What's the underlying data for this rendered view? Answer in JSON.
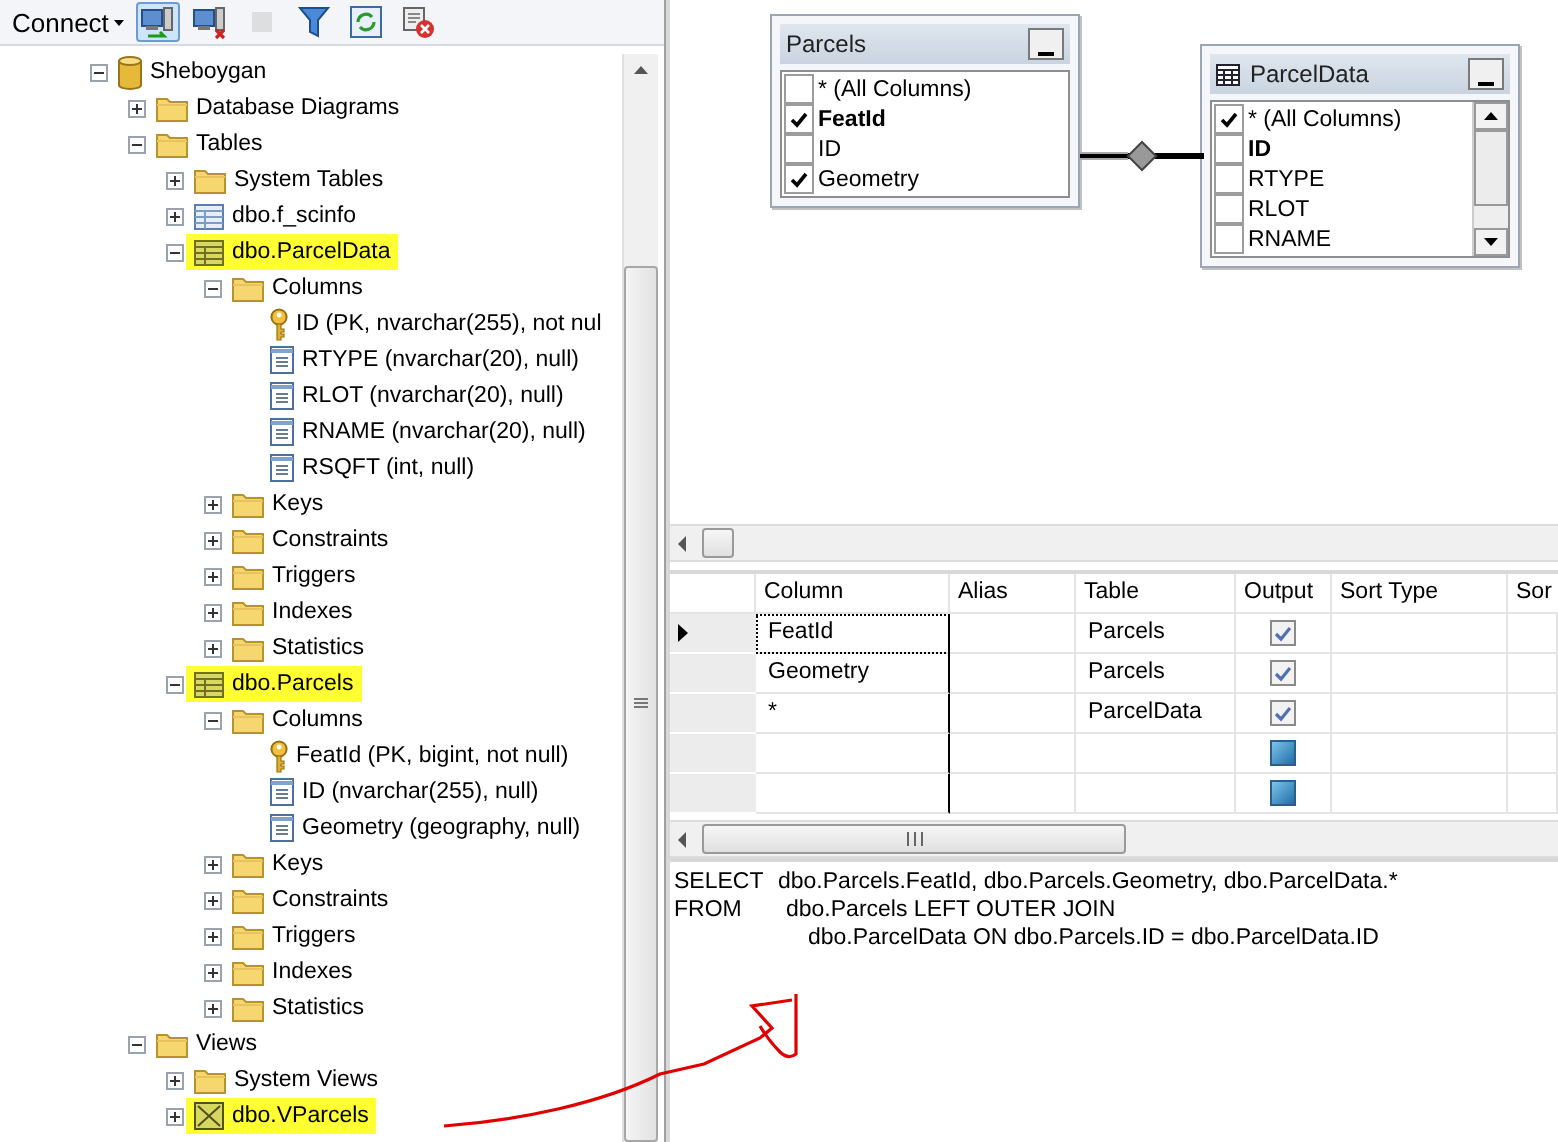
{
  "toolbar": {
    "connect_label": "Connect",
    "tools": [
      {
        "kind": "connect",
        "selected": true,
        "disabled": false
      },
      {
        "kind": "disconnect",
        "selected": false,
        "disabled": false
      },
      {
        "kind": "stop",
        "selected": false,
        "disabled": true
      },
      {
        "kind": "filter",
        "selected": false,
        "disabled": false
      },
      {
        "kind": "refresh",
        "selected": false,
        "disabled": false
      },
      {
        "kind": "script",
        "selected": false,
        "disabled": false
      }
    ]
  },
  "tree": [
    {
      "label": "Sheboygan",
      "kind": "database",
      "expanded": true,
      "highlighted": false,
      "children": [
        {
          "label": "Database Diagrams",
          "kind": "folder",
          "expanded": false,
          "highlighted": false
        },
        {
          "label": "Tables",
          "kind": "folder",
          "expanded": true,
          "highlighted": false,
          "children": [
            {
              "label": "System Tables",
              "kind": "folder",
              "expanded": false,
              "highlighted": false
            },
            {
              "label": "dbo.f_scinfo",
              "kind": "table",
              "expanded": false,
              "highlighted": false
            },
            {
              "label": "dbo.ParcelData",
              "kind": "table",
              "expanded": true,
              "highlighted": true,
              "children": [
                {
                  "label": "Columns",
                  "kind": "folder",
                  "expanded": true,
                  "highlighted": false,
                  "children": [
                    {
                      "label": "ID (PK, nvarchar(255), not nul",
                      "kind": "key",
                      "highlighted": false
                    },
                    {
                      "label": "RTYPE (nvarchar(20), null)",
                      "kind": "column",
                      "highlighted": false
                    },
                    {
                      "label": "RLOT (nvarchar(20), null)",
                      "kind": "column",
                      "highlighted": false
                    },
                    {
                      "label": "RNAME (nvarchar(20), null)",
                      "kind": "column",
                      "highlighted": false
                    },
                    {
                      "label": "RSQFT (int, null)",
                      "kind": "column",
                      "highlighted": false
                    }
                  ]
                },
                {
                  "label": "Keys",
                  "kind": "folder",
                  "expanded": false,
                  "highlighted": false
                },
                {
                  "label": "Constraints",
                  "kind": "folder",
                  "expanded": false,
                  "highlighted": false
                },
                {
                  "label": "Triggers",
                  "kind": "folder",
                  "expanded": false,
                  "highlighted": false
                },
                {
                  "label": "Indexes",
                  "kind": "folder",
                  "expanded": false,
                  "highlighted": false
                },
                {
                  "label": "Statistics",
                  "kind": "folder",
                  "expanded": false,
                  "highlighted": false
                }
              ]
            },
            {
              "label": "dbo.Parcels",
              "kind": "table",
              "expanded": true,
              "highlighted": true,
              "children": [
                {
                  "label": "Columns",
                  "kind": "folder",
                  "expanded": true,
                  "highlighted": false,
                  "children": [
                    {
                      "label": "FeatId (PK, bigint, not null)",
                      "kind": "key",
                      "highlighted": false
                    },
                    {
                      "label": "ID (nvarchar(255), null)",
                      "kind": "column",
                      "highlighted": false
                    },
                    {
                      "label": "Geometry (geography, null)",
                      "kind": "column",
                      "highlighted": false
                    }
                  ]
                },
                {
                  "label": "Keys",
                  "kind": "folder",
                  "expanded": false,
                  "highlighted": false
                },
                {
                  "label": "Constraints",
                  "kind": "folder",
                  "expanded": false,
                  "highlighted": false
                },
                {
                  "label": "Triggers",
                  "kind": "folder",
                  "expanded": false,
                  "highlighted": false
                },
                {
                  "label": "Indexes",
                  "kind": "folder",
                  "expanded": false,
                  "highlighted": false
                },
                {
                  "label": "Statistics",
                  "kind": "folder",
                  "expanded": false,
                  "highlighted": false
                }
              ]
            }
          ]
        },
        {
          "label": "Views",
          "kind": "folder",
          "expanded": true,
          "highlighted": false,
          "children": [
            {
              "label": "System Views",
              "kind": "folder",
              "expanded": false,
              "highlighted": false
            },
            {
              "label": "dbo.VParcels",
              "kind": "view",
              "expanded": false,
              "highlighted": true
            }
          ]
        }
      ]
    }
  ],
  "diagram": {
    "tables": [
      {
        "title": "Parcels",
        "show_icon": false,
        "scrollable": false,
        "columns": [
          {
            "name": "* (All Columns)",
            "checked": false,
            "primary_key": false
          },
          {
            "name": "FeatId",
            "checked": true,
            "primary_key": true
          },
          {
            "name": "ID",
            "checked": false,
            "primary_key": false
          },
          {
            "name": "Geometry",
            "checked": true,
            "primary_key": false
          }
        ]
      },
      {
        "title": "ParcelData",
        "show_icon": true,
        "scrollable": true,
        "columns": [
          {
            "name": "* (All Columns)",
            "checked": true,
            "primary_key": false
          },
          {
            "name": "ID",
            "checked": false,
            "primary_key": true
          },
          {
            "name": "RTYPE",
            "checked": false,
            "primary_key": false
          },
          {
            "name": "RLOT",
            "checked": false,
            "primary_key": false
          },
          {
            "name": "RNAME",
            "checked": false,
            "primary_key": false
          }
        ]
      }
    ]
  },
  "grid": {
    "columns": [
      "Column",
      "Alias",
      "Table",
      "Output",
      "Sort Type",
      "Sor"
    ],
    "rows": [
      {
        "column": "FeatId",
        "table": "Parcels",
        "output": true,
        "current": true
      },
      {
        "column": "Geometry",
        "table": "Parcels",
        "output": true,
        "current": false
      },
      {
        "column": "*",
        "table": "ParcelData",
        "output": true,
        "current": false
      },
      {
        "output": false,
        "current": false
      },
      {
        "output": false,
        "current": false
      }
    ]
  },
  "sql": [
    {
      "keyword": "SELECT",
      "text": "dbo.Parcels.FeatId, dbo.Parcels.Geometry, dbo.ParcelData.*"
    },
    {
      "keyword": "FROM",
      "text": "dbo.Parcels LEFT OUTER JOIN"
    },
    {
      "text": "dbo.ParcelData ON dbo.Parcels.ID = dbo.ParcelData.ID"
    }
  ]
}
